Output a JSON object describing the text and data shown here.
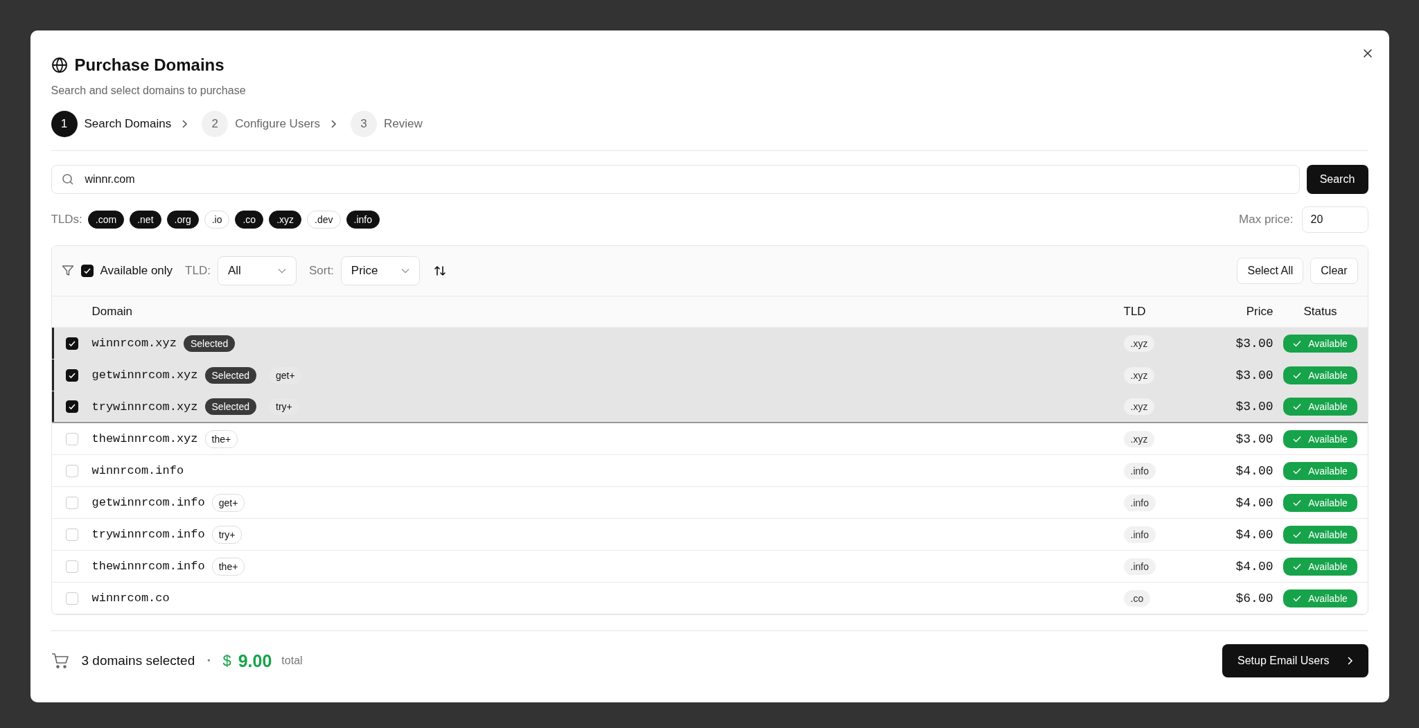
{
  "dialog": {
    "title": "Purchase Domains",
    "subtitle": "Search and select domains to purchase"
  },
  "steps": [
    {
      "number": "1",
      "label": "Search Domains",
      "selected": true
    },
    {
      "number": "2",
      "label": "Configure Users",
      "selected": false
    },
    {
      "number": "3",
      "label": "Review",
      "selected": false
    }
  ],
  "search": {
    "value": "winnr.com",
    "button": "Search"
  },
  "tld_filter": {
    "label": "TLDs:",
    "chips": [
      {
        "label": ".com",
        "selected": true
      },
      {
        "label": ".net",
        "selected": true
      },
      {
        "label": ".org",
        "selected": true
      },
      {
        "label": ".io",
        "selected": false
      },
      {
        "label": ".co",
        "selected": true
      },
      {
        "label": ".xyz",
        "selected": true
      },
      {
        "label": ".dev",
        "selected": false
      },
      {
        "label": ".info",
        "selected": true
      }
    ]
  },
  "max_price": {
    "label": "Max price:",
    "value": "20"
  },
  "toolbar": {
    "available_only": {
      "label": "Available only",
      "checked": true
    },
    "tld_label": "TLD:",
    "tld_value": "All",
    "sort_label": "Sort:",
    "sort_value": "Price",
    "buttons": [
      "Select All",
      "Clear"
    ]
  },
  "table": {
    "columns": [
      "Domain",
      "TLD",
      "Price",
      "Status"
    ],
    "rows": [
      {
        "domain": "winnrcom.xyz",
        "badge": "Selected",
        "tag": null,
        "selected": true,
        "tld": ".xyz",
        "price": "$3.00",
        "status": "Available"
      },
      {
        "domain": "getwinnrcom.xyz",
        "badge": "Selected",
        "tag": "get+",
        "selected": true,
        "tld": ".xyz",
        "price": "$3.00",
        "status": "Available"
      },
      {
        "domain": "trywinnrcom.xyz",
        "badge": "Selected",
        "tag": "try+",
        "selected": true,
        "tld": ".xyz",
        "price": "$3.00",
        "status": "Available"
      },
      {
        "domain": "thewinnrcom.xyz",
        "tag": "the+",
        "selected": false,
        "tld": ".xyz",
        "price": "$3.00",
        "status": "Available"
      },
      {
        "domain": "winnrcom.info",
        "tag": null,
        "selected": false,
        "tld": ".info",
        "price": "$4.00",
        "status": "Available"
      },
      {
        "domain": "getwinnrcom.info",
        "tag": "get+",
        "selected": false,
        "tld": ".info",
        "price": "$4.00",
        "status": "Available"
      },
      {
        "domain": "trywinnrcom.info",
        "tag": "try+",
        "selected": false,
        "tld": ".info",
        "price": "$4.00",
        "status": "Available"
      },
      {
        "domain": "thewinnrcom.info",
        "tag": "the+",
        "selected": false,
        "tld": ".info",
        "price": "$4.00",
        "status": "Available"
      },
      {
        "domain": "winnrcom.co",
        "tag": null,
        "selected": false,
        "tld": ".co",
        "price": "$6.00",
        "status": "Available"
      }
    ]
  },
  "footer": {
    "selected_count": "3 domains selected",
    "separator": "•",
    "currency": "$",
    "total": "9.00",
    "total_label": "total",
    "next_button": "Setup Email Users"
  }
}
